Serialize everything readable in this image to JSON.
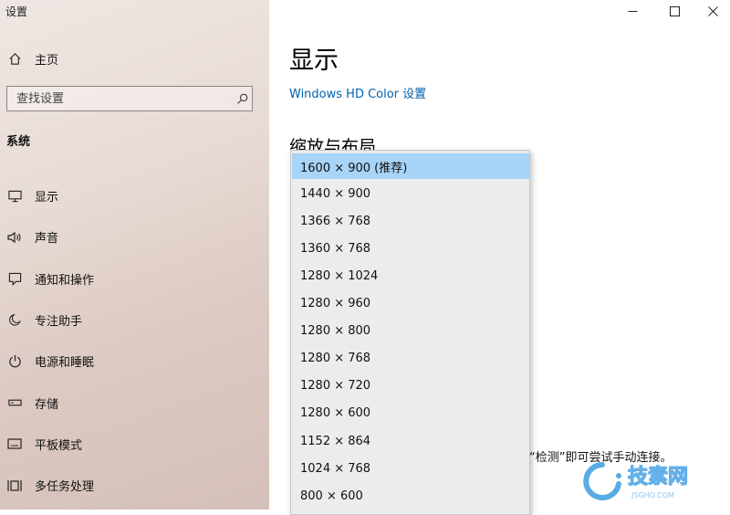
{
  "window": {
    "app_title": "设置"
  },
  "sidebar": {
    "home_label": "主页",
    "search_placeholder": "查找设置",
    "section_label": "系统",
    "items": [
      {
        "label": "显示",
        "icon": "monitor-icon"
      },
      {
        "label": "声音",
        "icon": "speaker-icon"
      },
      {
        "label": "通知和操作",
        "icon": "notification-icon"
      },
      {
        "label": "专注助手",
        "icon": "moon-icon"
      },
      {
        "label": "电源和睡眠",
        "icon": "power-icon"
      },
      {
        "label": "存储",
        "icon": "storage-icon"
      },
      {
        "label": "平板模式",
        "icon": "tablet-icon"
      },
      {
        "label": "多任务处理",
        "icon": "multitask-icon"
      }
    ]
  },
  "main": {
    "page_title": "显示",
    "hd_link": "Windows HD Color 设置",
    "section_heading": "缩放与布局",
    "hint_text": "“检测”即可尝试手动连接。"
  },
  "dropdown": {
    "selected_index": 0,
    "options": [
      "1600 × 900 (推荐)",
      "1440 × 900",
      "1366 × 768",
      "1360 × 768",
      "1280 × 1024",
      "1280 × 960",
      "1280 × 800",
      "1280 × 768",
      "1280 × 720",
      "1280 × 600",
      "1152 × 864",
      "1024 × 768",
      "800 × 600"
    ]
  },
  "watermark": {
    "text": "技素网",
    "subtext": "JSGHO.COM"
  },
  "colors": {
    "accent_link": "#0063b1",
    "selected_option": "#a8d4f7"
  }
}
